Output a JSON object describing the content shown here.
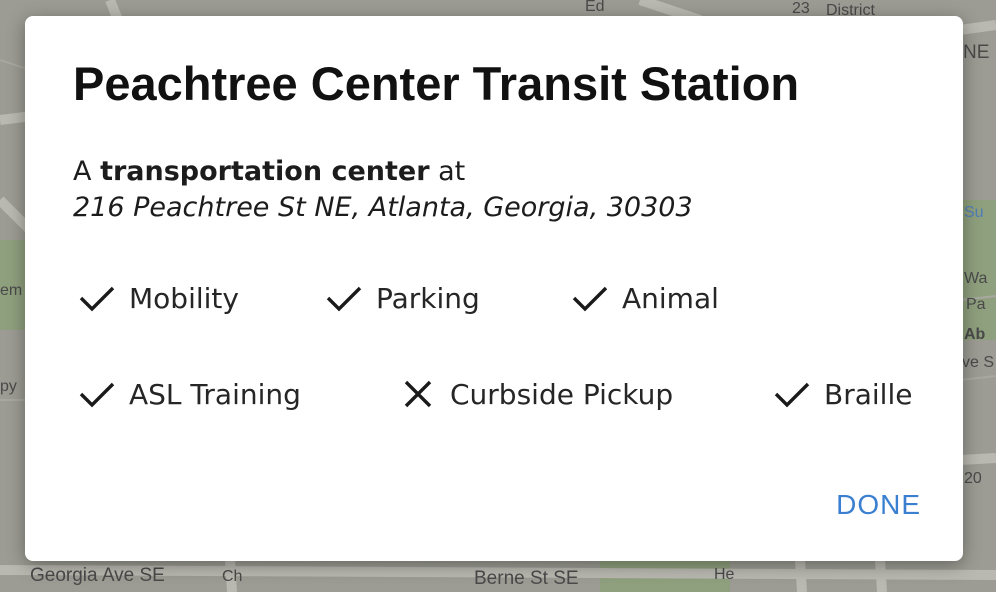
{
  "map": {
    "labels": [
      "Georgia Ave SE",
      "Berne St SE",
      "District",
      "NE",
      "Ed",
      "Ch",
      "He",
      "Su",
      "Wa",
      "Pa",
      "Ab",
      "ve S",
      "em",
      "py",
      "23",
      "20"
    ]
  },
  "dialog": {
    "title": "Peachtree Center Transit Station",
    "description_prefix": "A ",
    "description_bold": "transportation center",
    "description_suffix": " at",
    "address": "216 Peachtree St NE, Atlanta, Georgia, 30303",
    "features": [
      {
        "label": "Mobility",
        "available": true,
        "icon": "check-icon"
      },
      {
        "label": "Parking",
        "available": true,
        "icon": "check-icon"
      },
      {
        "label": "Animal",
        "available": true,
        "icon": "check-icon"
      },
      {
        "label": "ASL Training",
        "available": true,
        "icon": "check-icon"
      },
      {
        "label": "Curbside Pickup",
        "available": false,
        "icon": "close-icon"
      },
      {
        "label": "Braille",
        "available": true,
        "icon": "check-icon"
      }
    ],
    "done_label": "DONE"
  },
  "colors": {
    "accent": "#3a7fd0",
    "text": "#111111",
    "map_background": "#9c9c94",
    "map_road": "#b5b5ad",
    "map_park": "#8fa07e"
  }
}
